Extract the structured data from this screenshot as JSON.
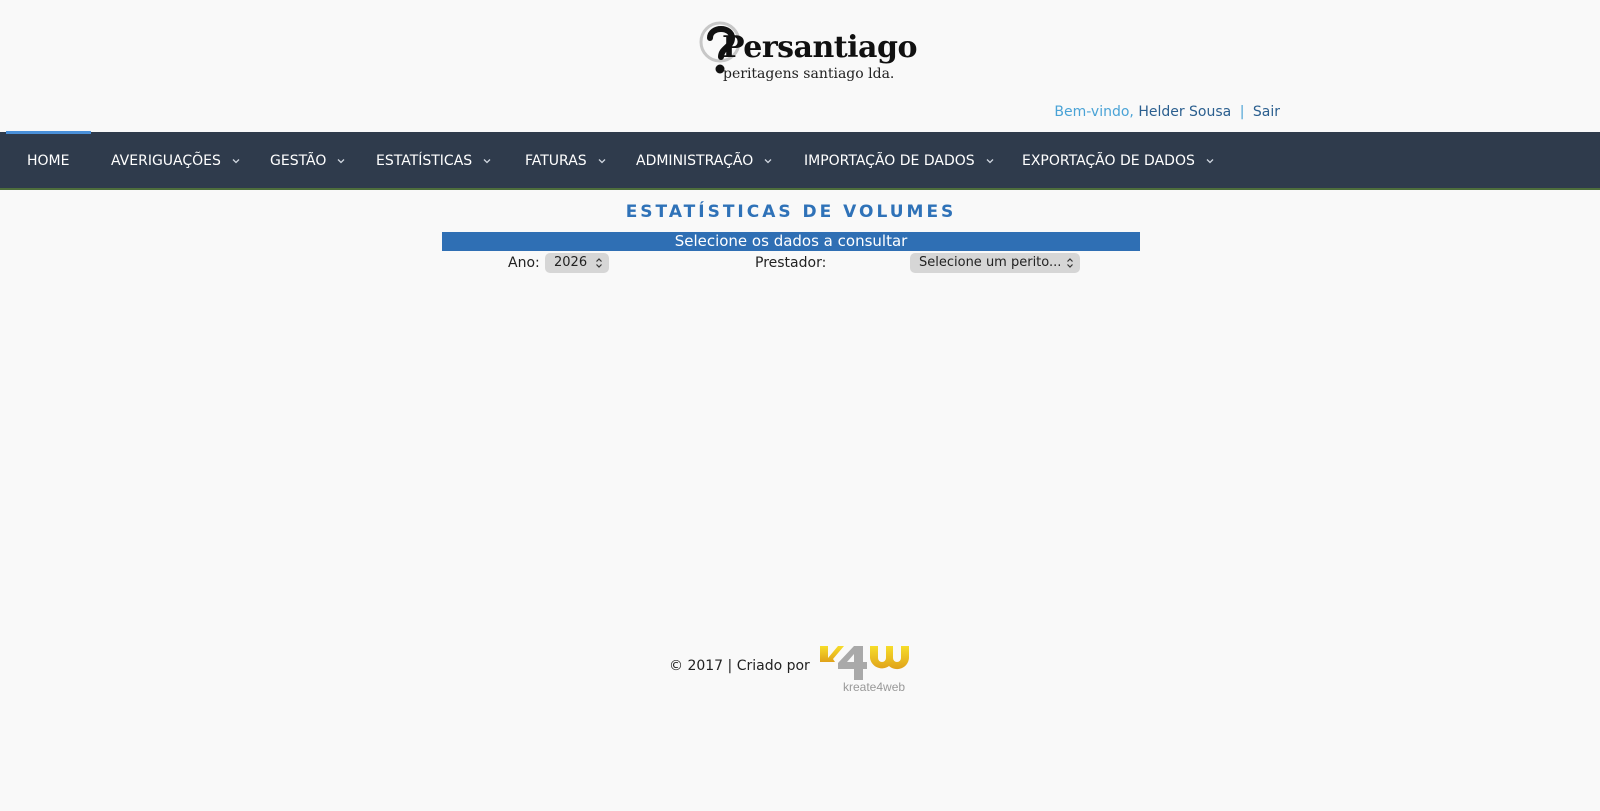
{
  "brand": {
    "name": "Persantiago",
    "tagline": "peritagens santiago lda."
  },
  "user_bar": {
    "greeting": "Bem-vindo,",
    "user_name": "Helder Sousa",
    "separator": "|",
    "logout": "Sair"
  },
  "nav": {
    "items": [
      {
        "label": "HOME",
        "has_dropdown": false,
        "active": true
      },
      {
        "label": "AVERIGUAÇÕES",
        "has_dropdown": true
      },
      {
        "label": "GESTÃO",
        "has_dropdown": true
      },
      {
        "label": "ESTATÍSTICAS",
        "has_dropdown": true
      },
      {
        "label": "FATURAS",
        "has_dropdown": true
      },
      {
        "label": "ADMINISTRAÇÃO",
        "has_dropdown": true
      },
      {
        "label": "IMPORTAÇÃO DE DADOS",
        "has_dropdown": true
      },
      {
        "label": "EXPORTAÇÃO DE DADOS",
        "has_dropdown": true
      }
    ]
  },
  "main": {
    "title": "ESTATÍSTICAS DE VOLUMES",
    "panel_header": "Selecione os dados a consultar",
    "year": {
      "label": "Ano:",
      "value": "2026"
    },
    "provider": {
      "label": "Prestador:",
      "placeholder": "Selecione um perito..."
    }
  },
  "footer": {
    "text": "© 2017 | Criado por",
    "logo_mark": "K4W",
    "logo_text": "kreate4web"
  },
  "colors": {
    "nav_bg": "#2f3b4c",
    "accent_blue": "#2f6fb4",
    "title_blue": "#2f72b8",
    "link_light": "#4aa3d6",
    "link_dark": "#2b5f8f",
    "footer_yellow": "#f2d21b"
  },
  "icons": {
    "nav_dropdown": "chevron-down-icon",
    "select_arrows": "updown-arrows-icon"
  }
}
